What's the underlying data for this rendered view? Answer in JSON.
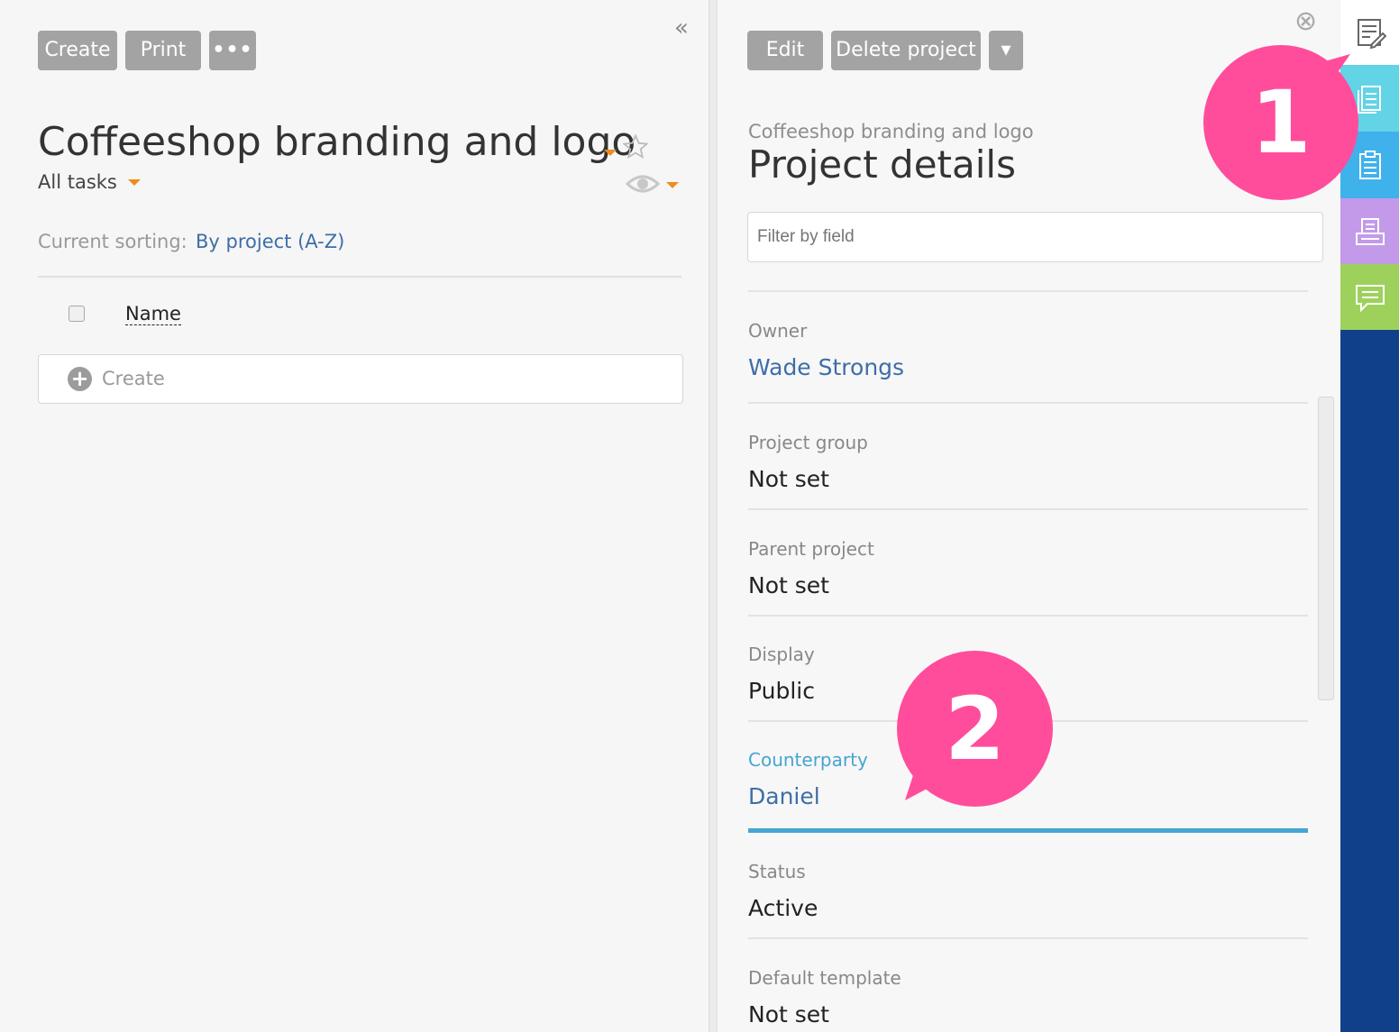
{
  "left": {
    "toolbar": {
      "create_label": "Create",
      "print_label": "Print",
      "more_label": "•••"
    },
    "collapse_glyph": "«",
    "title": "Coffeeshop branding and logo",
    "filter_label": "All tasks",
    "sorting_label": "Current sorting:",
    "sorting_value": "By project (A-Z)",
    "column_name": "Name",
    "create_row_label": "Create"
  },
  "right": {
    "toolbar": {
      "edit_label": "Edit",
      "delete_label": "Delete project",
      "dropdown_glyph": "▾"
    },
    "close_glyph": "⊗",
    "subtitle": "Coffeeshop branding and logo",
    "title": "Project details",
    "filter_placeholder": "Filter by field",
    "fields": [
      {
        "label": "Owner",
        "value": "Wade Strongs"
      },
      {
        "label": "Project group",
        "value": "Not set"
      },
      {
        "label": "Parent project",
        "value": "Not set"
      },
      {
        "label": "Display",
        "value": "Public"
      },
      {
        "label": "Counterparty",
        "value": "Daniel"
      },
      {
        "label": "Status",
        "value": "Active"
      },
      {
        "label": "Default template",
        "value": "Not set"
      }
    ]
  },
  "rail": {
    "tabs": [
      {
        "icon": "edit-document-icon",
        "color": "#ffffff"
      },
      {
        "icon": "documents-icon",
        "color": "#63d3e6"
      },
      {
        "icon": "clipboard-icon",
        "color": "#3fb2ec"
      },
      {
        "icon": "printer-icon",
        "color": "#c39ae9"
      },
      {
        "icon": "comment-icon",
        "color": "#9ed15c"
      }
    ],
    "background": "#10408a"
  },
  "callouts": {
    "one": "1",
    "two": "2",
    "color": "#ff4d9c"
  },
  "colors": {
    "accent_orange": "#f08c1f",
    "link_blue": "#3e6ea7",
    "active_field": "#46a5d2"
  }
}
